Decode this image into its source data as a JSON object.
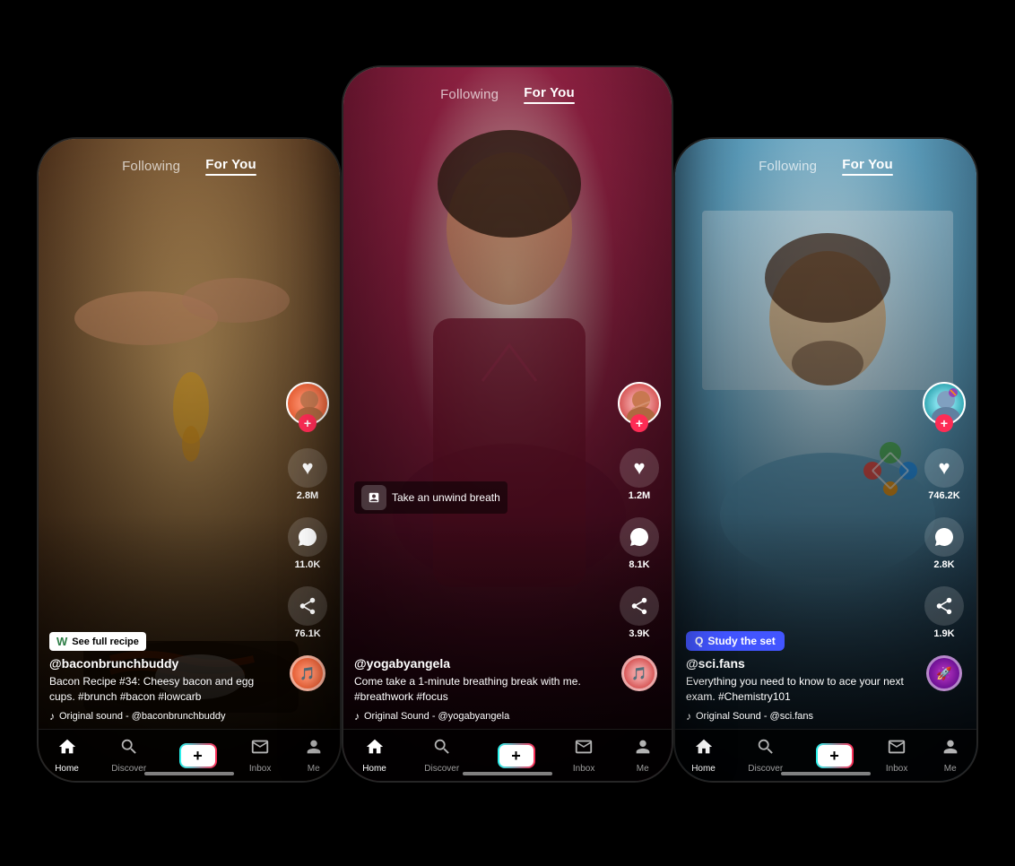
{
  "phones": {
    "left": {
      "nav": {
        "following": "Following",
        "for_you": "For You",
        "active": "for_you"
      },
      "video": {
        "bg_class": "bg-cooking",
        "tag": "See full recipe",
        "tag_icon": "W",
        "username": "@baconbrunchbuddy",
        "description": "Bacon Recipe #34: Cheesy bacon and egg cups. #brunch #bacon #lowcarb",
        "sound": "Original sound - @baconbrunchbuddy",
        "likes": "2.8M",
        "comments": "11.0K",
        "shares": "76.1K"
      },
      "bottom_nav": {
        "home": "Home",
        "discover": "Discover",
        "inbox": "Inbox",
        "me": "Me"
      }
    },
    "center": {
      "nav": {
        "following": "Following",
        "for_you": "For You",
        "active": "for_you"
      },
      "video": {
        "bg_class": "bg-yoga",
        "caption": "Take an unwind breath",
        "username": "@yogabyangela",
        "description": "Come take a 1-minute breathing break with me. #breathwork #focus",
        "sound": "Original Sound - @yogabyangela",
        "likes": "1.2M",
        "comments": "8.1K",
        "shares": "3.9K"
      },
      "bottom_nav": {
        "home": "Home",
        "discover": "Discover",
        "inbox": "Inbox",
        "me": "Me"
      }
    },
    "right": {
      "nav": {
        "following": "Following",
        "for_you": "For You",
        "active": "for_you"
      },
      "video": {
        "bg_class": "bg-science",
        "tag": "Study the set",
        "tag_icon": "Q",
        "username": "@sci.fans",
        "description": "Everything you need to know to ace your next exam. #Chemistry101",
        "sound": "Original Sound - @sci.fans",
        "likes": "746.2K",
        "comments": "2.8K",
        "shares": "1.9K"
      },
      "bottom_nav": {
        "home": "Home",
        "discover": "Discover",
        "inbox": "Inbox",
        "me": "Me"
      }
    }
  },
  "icons": {
    "heart": "♥",
    "comment": "💬",
    "share": "↗",
    "home": "⌂",
    "search": "🔍",
    "plus": "+",
    "inbox": "✉",
    "person": "👤",
    "music": "♪",
    "follow": "+"
  }
}
